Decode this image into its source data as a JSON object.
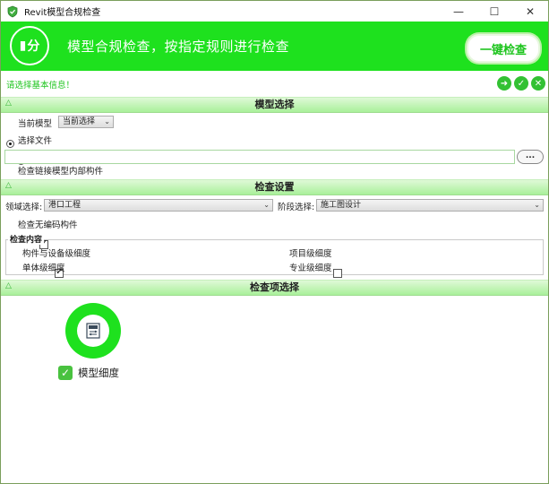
{
  "window": {
    "title": "Revit模型合规检查",
    "controls": {
      "minimize": "—",
      "maximize": "☐",
      "close": "✕"
    }
  },
  "banner": {
    "logo_text": "分",
    "title": "模型合规检查，按指定规则进行检查",
    "onekey_label": "一键检查",
    "color": "#1ee11e"
  },
  "info": {
    "message": "请选择基本信息！",
    "buttons": [
      "next-icon",
      "confirm-icon",
      "cancel-icon"
    ]
  },
  "model_section": {
    "header": "模型选择",
    "current_model_label": "当前模型",
    "current_model_selected": "当前选择",
    "select_file_label": "选择文件",
    "file_path": "",
    "browse_label": "...",
    "check_linked_label": "检查链接模型内部构件",
    "check_linked_checked": false,
    "current_model_checked": true
  },
  "settings_section": {
    "header": "检查设置",
    "domain_label": "领域选择:",
    "domain_value": "港口工程",
    "stage_label": "阶段选择:",
    "stage_value": "施工图设计",
    "check_uncoded_label": "检查无编码构件",
    "check_uncoded_checked": true,
    "content_group_label": "检查内容",
    "content_items": [
      {
        "label": "构件与设备级细度",
        "checked": true
      },
      {
        "label": "项目级细度",
        "checked": false
      },
      {
        "label": "单体级细度",
        "checked": false
      },
      {
        "label": "专业级细度",
        "checked": false
      }
    ]
  },
  "items_section": {
    "header": "检查项选择",
    "tiles": [
      {
        "label": "模型细度",
        "checked": true
      }
    ]
  }
}
